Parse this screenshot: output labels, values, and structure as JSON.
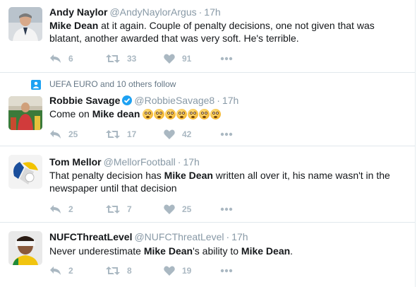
{
  "tweets": [
    {
      "name": "Andy Naylor",
      "handle": "@AndyNaylorArgus",
      "time": "17h",
      "text_parts": [
        {
          "bold": true,
          "t": "Mike Dean"
        },
        {
          "bold": false,
          "t": " at it again. Couple of penalty decisions, one not given that was blatant, another awarded that was very soft. He's terrible."
        }
      ],
      "replies": "6",
      "retweets": "33",
      "likes": "91"
    },
    {
      "social_context": "UEFA EURO and 10 others follow",
      "name": "Robbie Savage",
      "verified": true,
      "handle": "@RobbieSavage8",
      "time": "17h",
      "text_parts": [
        {
          "bold": false,
          "t": "Come on "
        },
        {
          "bold": true,
          "t": "Mike dean"
        },
        {
          "bold": false,
          "t": " "
        }
      ],
      "emoji_count": 7,
      "emoji": "flushed-face-emoji",
      "replies": "25",
      "retweets": "17",
      "likes": "42"
    },
    {
      "name": "Tom Mellor",
      "handle": "@MellorFootball",
      "time": "17h",
      "text_parts": [
        {
          "bold": false,
          "t": "That penalty decision has "
        },
        {
          "bold": true,
          "t": "Mike Dean"
        },
        {
          "bold": false,
          "t": " written all over it, his name wasn't in the newspaper until that decision"
        }
      ],
      "replies": "2",
      "retweets": "7",
      "likes": "25"
    },
    {
      "name": "NUFCThreatLevel",
      "handle": "@NUFCThreatLevel",
      "time": "17h",
      "text_parts": [
        {
          "bold": false,
          "t": "Never underestimate "
        },
        {
          "bold": true,
          "t": "Mike Dean"
        },
        {
          "bold": false,
          "t": "'s ability to "
        },
        {
          "bold": true,
          "t": "Mike Dean"
        },
        {
          "bold": false,
          "t": "."
        }
      ],
      "replies": "2",
      "retweets": "8",
      "likes": "19"
    }
  ],
  "icons": {
    "reply": "reply-icon",
    "retweet": "retweet-icon",
    "like": "heart-icon",
    "more": "more-icon",
    "social": "follow-context-icon",
    "verified": "verified-badge-icon"
  },
  "colors": {
    "action_gray": "#aab8c2",
    "meta_gray": "#8899a6",
    "verified_blue": "#1da1f2",
    "divider": "#e1e8ed"
  }
}
